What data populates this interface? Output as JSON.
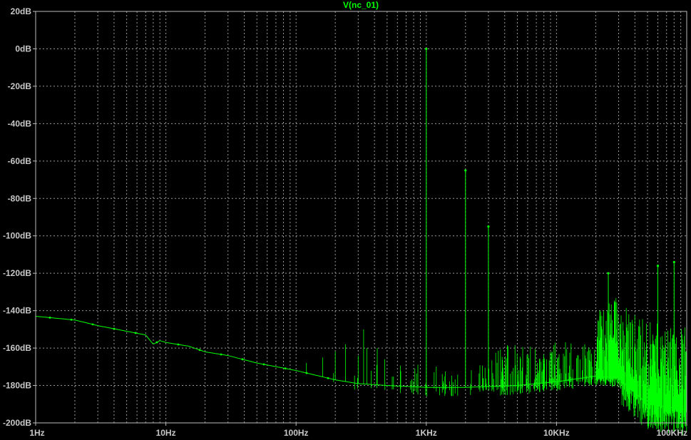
{
  "chart_data": {
    "type": "line",
    "title": "V(nc_01)",
    "xlabel": "",
    "ylabel": "",
    "x_scale": "log",
    "xlim": [
      "1Hz",
      "100KHz"
    ],
    "ylim": [
      -200,
      20
    ],
    "grid": true,
    "x_ticks": [
      {
        "value": 1,
        "label": "1Hz"
      },
      {
        "value": 10,
        "label": "10Hz"
      },
      {
        "value": 100,
        "label": "100Hz"
      },
      {
        "value": 1000,
        "label": "1KHz"
      },
      {
        "value": 10000,
        "label": "10KHz"
      },
      {
        "value": 100000,
        "label": "100KHz"
      }
    ],
    "y_ticks": [
      {
        "value": 20,
        "label": "20dB"
      },
      {
        "value": 0,
        "label": "0dB"
      },
      {
        "value": -20,
        "label": "-20dB"
      },
      {
        "value": -40,
        "label": "-40dB"
      },
      {
        "value": -60,
        "label": "-60dB"
      },
      {
        "value": -80,
        "label": "-80dB"
      },
      {
        "value": -100,
        "label": "-100dB"
      },
      {
        "value": -120,
        "label": "-120dB"
      },
      {
        "value": -140,
        "label": "-140dB"
      },
      {
        "value": -160,
        "label": "-160dB"
      },
      {
        "value": -180,
        "label": "-180dB"
      },
      {
        "value": -200,
        "label": "-200dB"
      }
    ],
    "series": [
      {
        "name": "V(nc_01)",
        "color": "#00ff00",
        "noise_floor": [
          [
            1,
            -143
          ],
          [
            2,
            -145
          ],
          [
            3,
            -148
          ],
          [
            5,
            -151
          ],
          [
            7,
            -153
          ],
          [
            8,
            -158
          ],
          [
            9,
            -156
          ],
          [
            10,
            -157
          ],
          [
            15,
            -159
          ],
          [
            20,
            -162
          ],
          [
            30,
            -164
          ],
          [
            50,
            -168
          ],
          [
            100,
            -172
          ],
          [
            200,
            -177
          ],
          [
            300,
            -179
          ],
          [
            500,
            -180
          ],
          [
            1000,
            -181
          ],
          [
            2000,
            -181
          ],
          [
            5000,
            -180
          ],
          [
            10000,
            -178
          ],
          [
            20000,
            -175
          ],
          [
            30000,
            -176
          ],
          [
            50000,
            -190
          ],
          [
            100000,
            -193
          ]
        ],
        "peaks": [
          {
            "x": 1000,
            "y": 0
          },
          {
            "x": 2000,
            "y": -65
          },
          {
            "x": 3000,
            "y": -95
          },
          {
            "x": 80000,
            "y": -114
          },
          {
            "x": 60000,
            "y": -116
          },
          {
            "x": 25000,
            "y": -120
          }
        ]
      }
    ]
  },
  "colors": {
    "background": "#000000",
    "grid": "#9a9a9a",
    "axis_text": "#c8c8c8",
    "title": "#00ff00",
    "trace": "#00ff00"
  }
}
